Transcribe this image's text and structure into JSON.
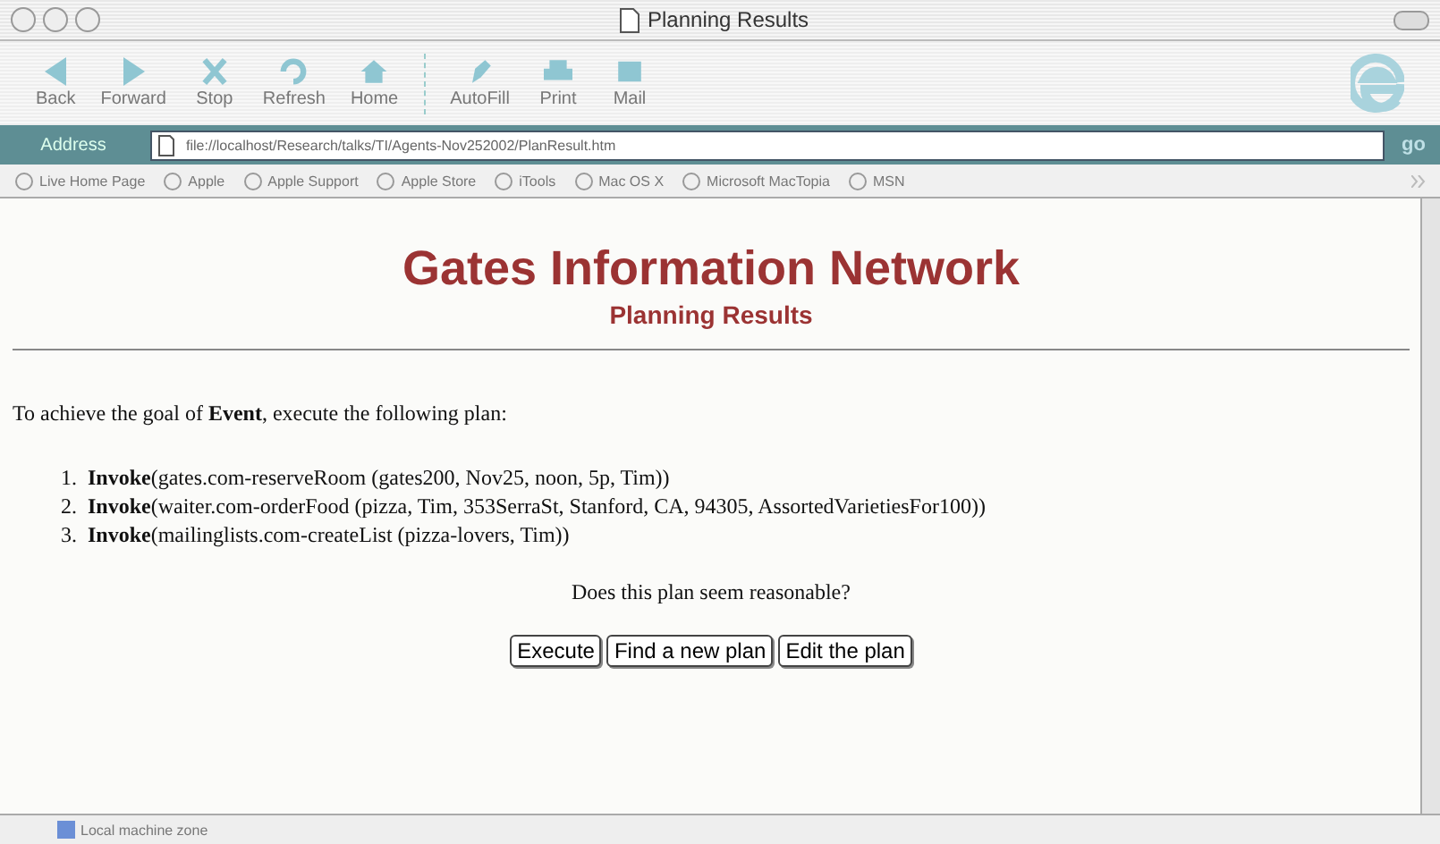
{
  "window": {
    "title": "Planning Results"
  },
  "toolbar": [
    "Back",
    "Forward",
    "Stop",
    "Refresh",
    "Home",
    "AutoFill",
    "Print",
    "Mail"
  ],
  "address": {
    "label": "Address",
    "value": "file://localhost/Research/talks/TI/Agents-Nov252002/PlanResult.htm",
    "go": "go"
  },
  "favorites": [
    "Live Home Page",
    "Apple",
    "Apple Support",
    "Apple Store",
    "iTools",
    "Mac OS X",
    "Microsoft MacTopia",
    "MSN"
  ],
  "page": {
    "heading": "Gates Information Network",
    "subheading": "Planning Results",
    "intro": "To achieve the goal of **Event**, execute the following plan:",
    "plan": [
      {
        "number": "1.",
        "text": "**Invoke**(gates.com-reserveRoom (gates200, Nov25, noon, 5p, Tim))"
      },
      {
        "number": "2.",
        "text": "**Invoke**(waiter.com-orderFood (pizza, Tim, 353SerraSt, Stanford, CA, 94305, AssortedVarietiesFor100))"
      },
      {
        "number": "3.",
        "text": "**Invoke**(mailinglists.com-createList (pizza-lovers, Tim))"
      }
    ],
    "question": "Does this plan seem reasonable?",
    "buttons": [
      "Execute",
      "Find a new plan",
      "Edit the plan"
    ]
  },
  "status_bar": "Local machine zone"
}
